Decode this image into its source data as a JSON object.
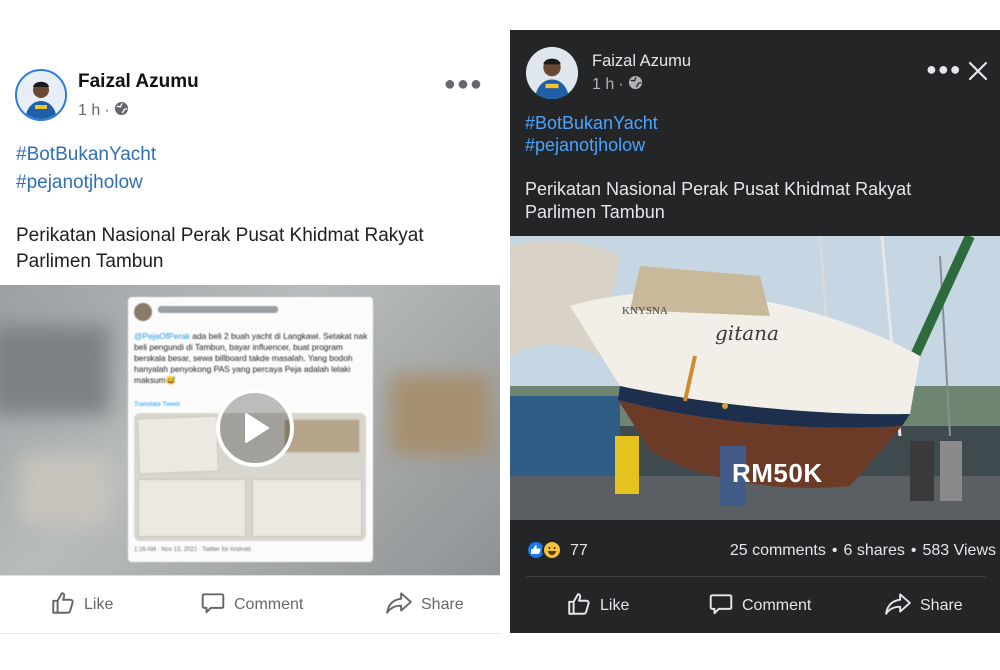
{
  "left_post": {
    "author": "Faizal Azumu",
    "time": "1 h",
    "separator": "·",
    "hashtags": [
      "#BotBukanYacht",
      "#pejanotjholow"
    ],
    "text": "Perikatan Nasional Perak Pusat Khidmat Rakyat Parlimen Tambun",
    "more_icon": "more-dots-icon",
    "privacy_icon": "globe-icon",
    "video": {
      "embedded_tweet": {
        "mention": "@PejaOfPerak",
        "body": " ada beli 2 buah yacht di Langkawi. Setakat nak beli pengundi di Tambun, bayar influencer, buat program  berskala besar, sewa billboard takde masalah. Yang bodoh hanyalah penyokong PAS yang percaya Peja adalah lelaki maksum😅",
        "translate": "Translate Tweet",
        "footer": "1:16 AM · Nov 13, 2022 · Twitter for Android"
      },
      "play_icon": "play-icon"
    },
    "actions": {
      "like": "Like",
      "comment": "Comment",
      "share": "Share"
    }
  },
  "right_post": {
    "author": "Faizal Azumu",
    "time": "1 h",
    "hashtags": [
      "#BotBukanYacht",
      "#pejanotjholow"
    ],
    "text": "Perikatan Nasional Perak Pusat Khidmat Rakyat Parlimen Tambun",
    "image": {
      "hull_name": "KNYSNA",
      "boat_name": "gitana",
      "overlay_price": "RM50K"
    },
    "stats": {
      "reaction_count": "77",
      "comments": "25 comments",
      "shares": "6 shares",
      "views": "583 Views",
      "bullet": "•"
    },
    "actions": {
      "like": "Like",
      "comment": "Comment",
      "share": "Share"
    }
  },
  "colors": {
    "light_bg": "#ffffff",
    "dark_bg": "#242526",
    "hashtag_light": "#2f6fb5",
    "hashtag_dark": "#4aa3ff",
    "like_reaction": "#1877f2",
    "haha_reaction": "#f7c33c"
  }
}
